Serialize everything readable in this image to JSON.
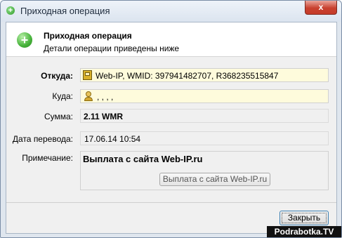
{
  "window": {
    "title": "Приходная операция",
    "close_label": "x"
  },
  "header": {
    "title": "Приходная операция",
    "subtitle": "Детали операции приведены ниже",
    "icon": "plus-icon"
  },
  "form": {
    "from": {
      "label": "Откуда:",
      "value": "Web-IP, WMID: 397941482707, R368235515847",
      "icon": "webmoney-purse-icon"
    },
    "to": {
      "label": "Куда:",
      "value": ",                                       ,                        ,                      ,",
      "icon": "person-icon"
    },
    "amount": {
      "label": "Сумма:",
      "value": "2.11 WMR"
    },
    "date": {
      "label": "Дата перевода:",
      "value": "17.06.14 10:54"
    },
    "note": {
      "label": "Примечание:",
      "value": "Выплата с сайта Web-IP.ru",
      "button_label": "Выплата с сайта Web-IP.ru"
    }
  },
  "footer": {
    "close_label": "Закрыть"
  },
  "watermark": {
    "text": "Podrabotka.TV"
  }
}
